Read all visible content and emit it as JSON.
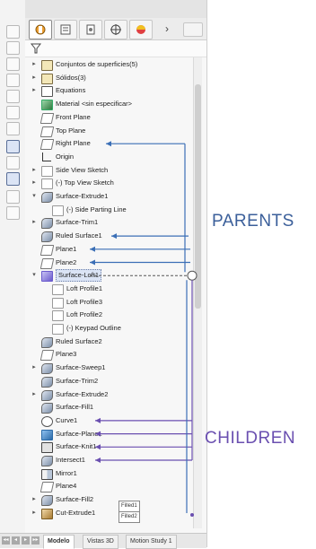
{
  "panel": {
    "tabs": [
      {
        "name": "feature-manager",
        "icon": "feature-manager-icon"
      },
      {
        "name": "property-manager",
        "icon": "property-manager-icon"
      },
      {
        "name": "configuration-manager",
        "icon": "configuration-manager-icon"
      },
      {
        "name": "dimxpert-manager",
        "icon": "dimxpert-icon"
      },
      {
        "name": "display-manager",
        "icon": "display-manager-icon"
      }
    ],
    "more_glyph": "›",
    "filter_icon": "filter-icon"
  },
  "tree": [
    {
      "label": "Conjuntos de superficies(5)",
      "icon": "folder",
      "exp": "▸"
    },
    {
      "label": "Sólidos(3)",
      "icon": "folder",
      "exp": "▸"
    },
    {
      "label": "Equations",
      "icon": "eq",
      "exp": "▸"
    },
    {
      "label": "Material <sin especificar>",
      "icon": "mat",
      "exp": ""
    },
    {
      "label": "Front Plane",
      "icon": "plane",
      "exp": ""
    },
    {
      "label": "Top Plane",
      "icon": "plane",
      "exp": ""
    },
    {
      "label": "Right Plane",
      "icon": "plane",
      "exp": ""
    },
    {
      "label": "Origin",
      "icon": "origin",
      "exp": ""
    },
    {
      "label": "Side View Sketch",
      "icon": "sketch",
      "exp": "▸"
    },
    {
      "label": "(-) Top View Sketch",
      "icon": "sketch",
      "exp": "▸"
    },
    {
      "label": "Surface-Extrude1",
      "icon": "surf",
      "exp": "▾"
    },
    {
      "label": "(-) Side Parting Line",
      "icon": "sketch",
      "exp": "",
      "indent": 1
    },
    {
      "label": "Surface-Trim1",
      "icon": "surf",
      "exp": "▸"
    },
    {
      "label": "Ruled Surface1",
      "icon": "surf",
      "exp": ""
    },
    {
      "label": "Plane1",
      "icon": "plane",
      "exp": ""
    },
    {
      "label": "Plane2",
      "icon": "plane",
      "exp": ""
    },
    {
      "label": "Surface-Loft1",
      "icon": "loft",
      "exp": "▾",
      "selected": true
    },
    {
      "label": "Loft Profile1",
      "icon": "sketch",
      "exp": "",
      "indent": 1
    },
    {
      "label": "Loft Profile3",
      "icon": "sketch",
      "exp": "",
      "indent": 1
    },
    {
      "label": "Loft Profile2",
      "icon": "sketch",
      "exp": "",
      "indent": 1
    },
    {
      "label": "(-) Keypad Outline",
      "icon": "sketch",
      "exp": "",
      "indent": 1
    },
    {
      "label": "Ruled Surface2",
      "icon": "surf",
      "exp": ""
    },
    {
      "label": "Plane3",
      "icon": "plane",
      "exp": ""
    },
    {
      "label": "Surface-Sweep1",
      "icon": "surf",
      "exp": "▸"
    },
    {
      "label": "Surface-Trim2",
      "icon": "surf",
      "exp": ""
    },
    {
      "label": "Surface-Extrude2",
      "icon": "surf",
      "exp": "▸"
    },
    {
      "label": "Surface-Fill1",
      "icon": "surf",
      "exp": ""
    },
    {
      "label": "Curve1",
      "icon": "curve",
      "exp": ""
    },
    {
      "label": "Surface-Plane1",
      "icon": "blue",
      "exp": ""
    },
    {
      "label": "Surface-Knit1",
      "icon": "knit",
      "exp": ""
    },
    {
      "label": "Intersect1",
      "icon": "surf",
      "exp": ""
    },
    {
      "label": "Mirror1",
      "icon": "mirror",
      "exp": ""
    },
    {
      "label": "Plane4",
      "icon": "plane",
      "exp": ""
    },
    {
      "label": "Surface-Fill2",
      "icon": "surf",
      "exp": "▸"
    },
    {
      "label": "Cut-Extrude1",
      "icon": "cut",
      "exp": "▸"
    }
  ],
  "hints": [
    "Filled1",
    "Filled2"
  ],
  "bottom_tabs": [
    "Modelo",
    "Vistas 3D",
    "Motion Study 1"
  ],
  "nav_glyphs": [
    "◂◂",
    "◂",
    "▸",
    "▸▸"
  ],
  "annotations": {
    "parents": "PARENTS",
    "children": "CHILDREN"
  },
  "colors": {
    "parents_arrow": "#3b6fb6",
    "children_arrow": "#6a4fb0",
    "selection": "#dbe4f5"
  }
}
